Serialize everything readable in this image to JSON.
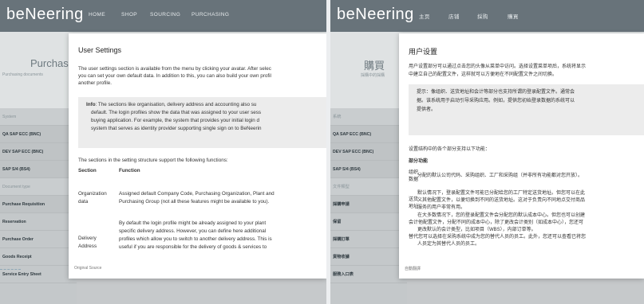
{
  "brand": {
    "logo": "beNeering"
  },
  "nav_en": [
    "HOME",
    "SHOP",
    "SOURCING",
    "PURCHASING"
  ],
  "nav_zh": [
    "主页",
    "店铺",
    "採购",
    "購買"
  ],
  "hero": {
    "title_en": "Purchas",
    "sub_en": "Purchasing documents",
    "title_zh": "購買",
    "sub_zh": "採購中的採購"
  },
  "sidebar_en": [
    "System",
    "QA SAP ECC (BNC)",
    "DEV SAP ECC (BNC)",
    "SAP S/4 (BS4)",
    "Document type",
    "Purchase Requisition",
    "Reservation",
    "Purchase Order",
    "Goods Receipt",
    "Service Entry Sheet"
  ],
  "sidebar_zh": [
    "系統",
    "QA SAP ECC (BNC)",
    "DEV SAP ECC (BNC)",
    "SAP S/4 (BS4)",
    "文件類型",
    "採購申請",
    "保留",
    "採購訂單",
    "貨物收據",
    "服務入口表"
  ],
  "modal_en": {
    "title": "User Settings",
    "intro_1": "The user settings section is available from the menu by clicking your avatar. After selec",
    "intro_2": "you can set your own default data. In addition to this, you can also build your own profil",
    "intro_3": "another profile.",
    "info_label": "Info",
    "info_1": ": The sections like organisation, delivery address and accounting also su",
    "info_2": "default. The login profiles show the data that was assigned to your user sess",
    "info_3": "buying application. For example, the system that provides your initial login d",
    "info_4": "system that serves as identity provider supporting single sign on to BeNeerin",
    "sections_intro": "The sections in the setting structure support the following functions:",
    "col_section": "Section",
    "col_function": "Function",
    "row1_section_1": "Organization",
    "row1_section_2": "data",
    "row1_function_1": "Assigned default Company Code, Purchasing Organization, Plant and",
    "row1_function_2": "Purchasing Group (not all these features might be available to you).",
    "row2_section_1": "Delivery",
    "row2_section_2": "Address",
    "row2_function_1": "By default the login profile might be already assigned to your plant",
    "row2_function_2": "specific delivery address. However, you can define here additional",
    "row2_function_3": "profiles which allow you to switch to another delivery address. This is",
    "row2_function_4": "useful if you are responsible for the delivery of goods & services to",
    "footer": "Original Source"
  },
  "modal_zh": {
    "title": "用户设置",
    "intro_1": "用户设置部分可以通过点击您的头像从菜单中访问。选择设置菜单项后，系统将显示",
    "intro_2": "中建立自己的配置文件，这样就可以方便地在不同配置文件之间切换。",
    "info_1": "提示：像组织、送货地址和会计等部分也支持所谓的登录配置文件。通常会",
    "info_2": "据。该系统用于启动引导采购应用。例如，提供您初始登录数据的系统可以",
    "info_3": "提供者。",
    "sections_intro": "设置结构中的各个部分支持以下功能：",
    "header": "部分功能",
    "org_label_1": "组织",
    "org_label_2": "数据",
    "org_text": "分配的默认公司代码、采购组织、工厂和采购组（并非所有功能都对您开放）。",
    "addr_label_1": "送货",
    "addr_label_2": "地址",
    "addr_1": "默认情况下，登录配置文件可能已分配给您的工厂特定送货地址。但您可以在此",
    "addr_2": "义其他配置文件，以便切换到不同的送货地址。这对于负责向不同地点交付商品",
    "addr_3": "服务的用户非常有用。",
    "acct_1": "在大多数情况下，您的登录配置文件会分配您的默认成本中心。但您也可以创建",
    "acct_2": "会计他配置文件，分配不同的成本中心，除了更改会计类别（如成本中心），您还可",
    "acct_3": "更改默认的会计类型，比如项目（WBS），内部订单等。",
    "sub_1": "替代您可以选择在采购系统中成为您的替代人员的员工。此外，您还可以查看已将您",
    "sub_2": "人员定为其替代人员的员工。",
    "footer": "自動翻譯"
  }
}
